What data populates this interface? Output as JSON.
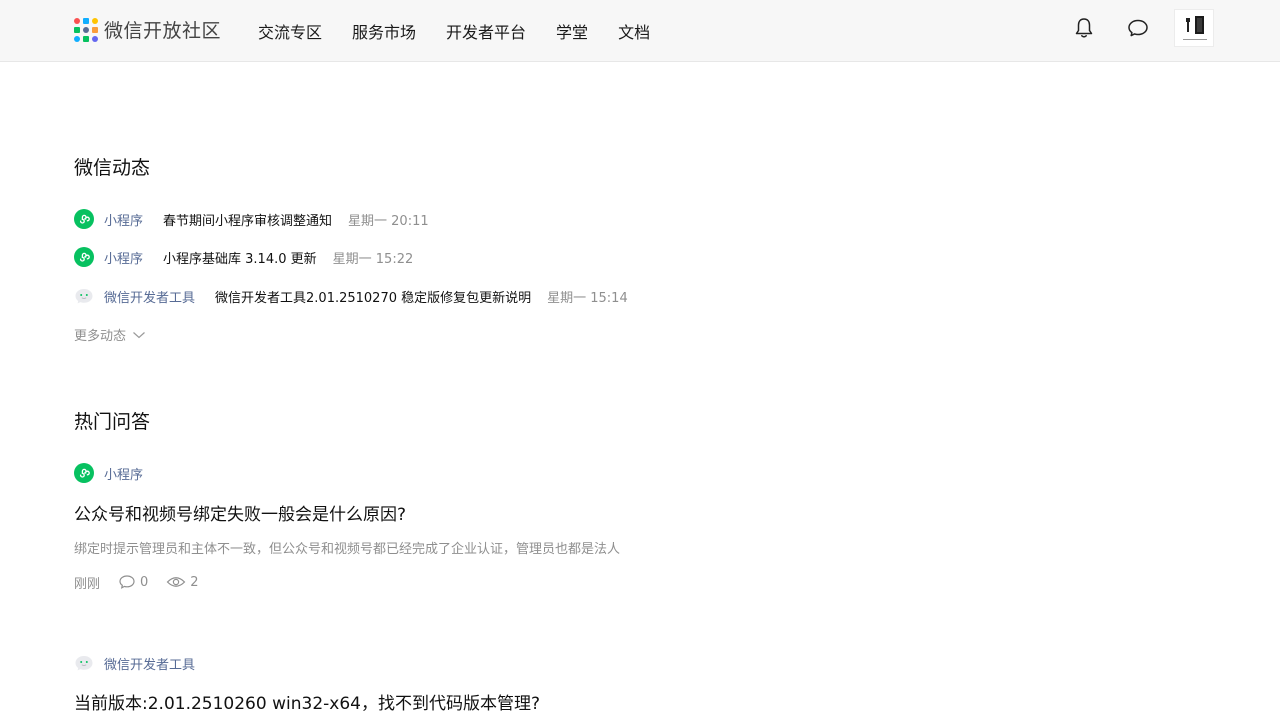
{
  "header": {
    "logo_text": "微信开放社区",
    "nav": [
      "交流专区",
      "服务市场",
      "开发者平台",
      "学堂",
      "文档"
    ],
    "logo_colors": [
      "#fa5151",
      "#10aeff",
      "#ffc300",
      "#07c160",
      "#576b95",
      "#fa9d3b",
      "#10aeff",
      "#07c160",
      "#6467f0"
    ]
  },
  "news": {
    "title": "微信动态",
    "items": [
      {
        "category": "小程序",
        "category_icon": "mini-program-icon",
        "title": "春节期间小程序审核调整通知",
        "time": "星期一 20:11"
      },
      {
        "category": "小程序",
        "category_icon": "mini-program-icon",
        "title": "小程序基础库 3.14.0 更新",
        "time": "星期一 15:22"
      },
      {
        "category": "微信开发者工具",
        "category_icon": "devtools-icon",
        "title": "微信开发者工具2.01.2510270 稳定版修复包更新说明",
        "time": "星期一 15:14"
      }
    ],
    "more_label": "更多动态"
  },
  "qa": {
    "title": "热门问答",
    "items": [
      {
        "category": "小程序",
        "category_icon": "mini-program-icon",
        "title": "公众号和视频号绑定失败一般会是什么原因?",
        "desc": "绑定时提示管理员和主体不一致，但公众号和视频号都已经完成了企业认证，管理员也都是法人",
        "time": "刚刚",
        "comments": "0",
        "views": "2"
      },
      {
        "category": "微信开发者工具",
        "category_icon": "devtools-icon",
        "title": "当前版本:2.01.2510260 win32-x64，找不到代码版本管理?"
      }
    ]
  },
  "colors": {
    "accent_green": "#07c160",
    "link_blue": "#576b95",
    "muted": "#8f8f8f"
  }
}
